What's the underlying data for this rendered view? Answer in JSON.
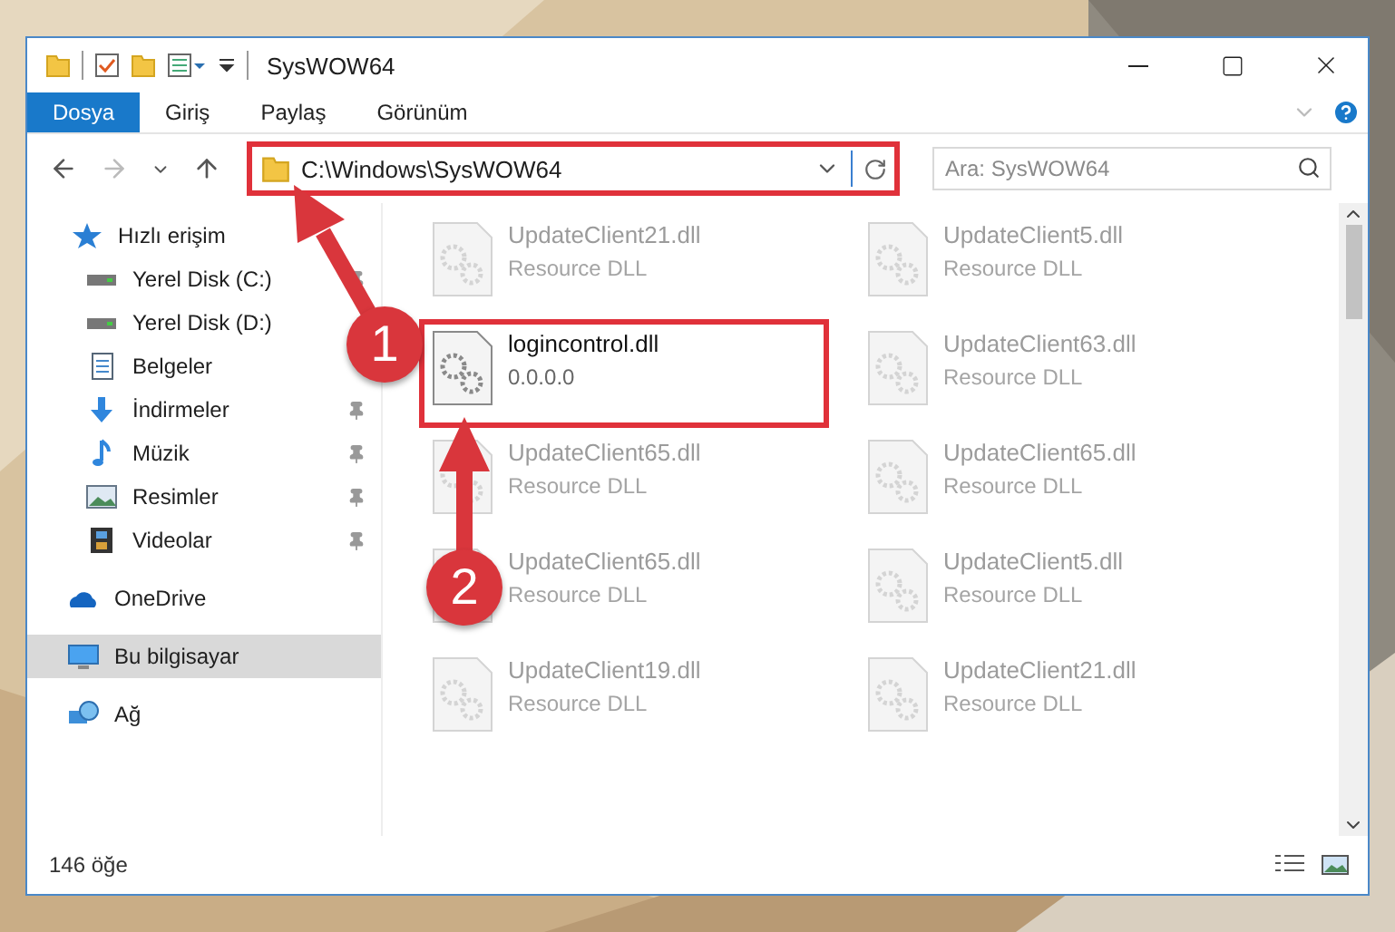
{
  "window": {
    "title": "SysWOW64"
  },
  "ribbon_tabs": [
    {
      "label": "Dosya",
      "kind": "file"
    },
    {
      "label": "Giriş",
      "kind": "tab"
    },
    {
      "label": "Paylaş",
      "kind": "tab"
    },
    {
      "label": "Görünüm",
      "kind": "tab"
    }
  ],
  "address": {
    "path": "C:\\Windows\\SysWOW64",
    "highlighted": true
  },
  "search": {
    "placeholder": "Ara: SysWOW64"
  },
  "sidebar": {
    "items": [
      {
        "label": "Hızlı erişim",
        "kind": "star",
        "selected": false,
        "children": [
          {
            "label": "Yerel Disk (C:)",
            "kind": "drive",
            "pinned": true,
            "selected": false
          },
          {
            "label": "Yerel Disk (D:)",
            "kind": "drive",
            "pinned": false,
            "selected": false
          },
          {
            "label": "Belgeler",
            "kind": "docs",
            "pinned": false,
            "selected": false
          },
          {
            "label": "İndirmeler",
            "kind": "download",
            "pinned": true,
            "selected": false
          },
          {
            "label": "Müzik",
            "kind": "music",
            "pinned": true,
            "selected": false
          },
          {
            "label": "Resimler",
            "kind": "pictures",
            "pinned": true,
            "selected": false
          },
          {
            "label": "Videolar",
            "kind": "video",
            "pinned": true,
            "selected": false
          }
        ]
      },
      {
        "label": "OneDrive",
        "kind": "cloud",
        "selected": false
      },
      {
        "label": "Bu bilgisayar",
        "kind": "pc",
        "selected": true
      },
      {
        "label": "Ağ",
        "kind": "network",
        "selected": false
      }
    ]
  },
  "files": [
    {
      "name": "UpdateClient21.dll",
      "detail": "Resource DLL",
      "blurred": true,
      "highlighted": false
    },
    {
      "name": "UpdateClient5.dll",
      "detail": "Resource DLL",
      "blurred": true,
      "highlighted": false
    },
    {
      "name": "logincontrol.dll",
      "detail": "0.0.0.0",
      "blurred": false,
      "highlighted": true
    },
    {
      "name": "UpdateClient63.dll",
      "detail": "Resource DLL",
      "blurred": true,
      "highlighted": false
    },
    {
      "name": "UpdateClient65.dll",
      "detail": "Resource DLL",
      "blurred": true,
      "highlighted": false
    },
    {
      "name": "UpdateClient65.dll",
      "detail": "Resource DLL",
      "blurred": true,
      "highlighted": false
    },
    {
      "name": "UpdateClient65.dll",
      "detail": "Resource DLL",
      "blurred": true,
      "highlighted": false
    },
    {
      "name": "UpdateClient5.dll",
      "detail": "Resource DLL",
      "blurred": true,
      "highlighted": false
    },
    {
      "name": "UpdateClient19.dll",
      "detail": "Resource DLL",
      "blurred": true,
      "highlighted": false
    },
    {
      "name": "UpdateClient21.dll",
      "detail": "Resource DLL",
      "blurred": true,
      "highlighted": false
    }
  ],
  "status_bar": {
    "count": "146 öğe"
  },
  "annotations": [
    {
      "number": "1"
    },
    {
      "number": "2"
    }
  ]
}
